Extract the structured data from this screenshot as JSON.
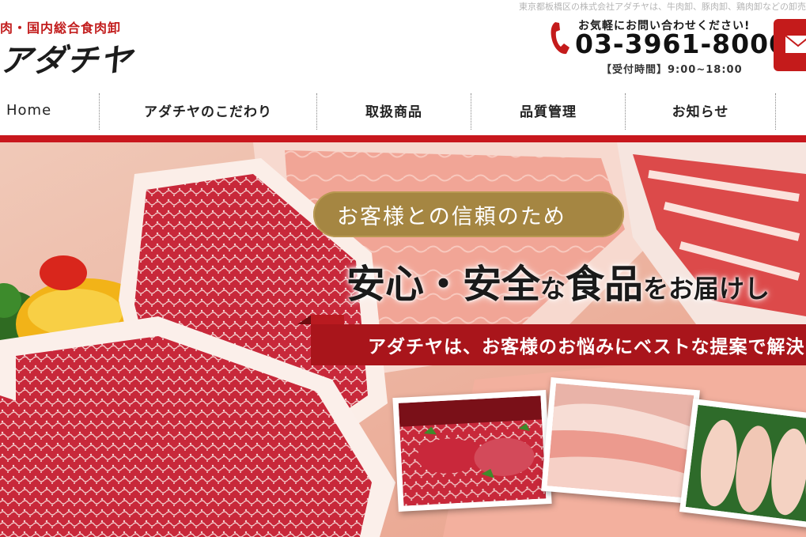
{
  "header": {
    "top_note": "東京都板橋区の株式会社アダチヤは、牛肉卸、豚肉卸、鶏肉卸などの卸売",
    "tagline": "肉・国内総合食肉卸",
    "logo_text": "アダチヤ",
    "contact": {
      "lead": "お気軽にお問い合わせください!",
      "phone": "03-3961-8000",
      "hours": "【受付時間】9:00~18:00"
    }
  },
  "nav": {
    "items": [
      {
        "label": "Home"
      },
      {
        "label": "アダチヤのこだわり"
      },
      {
        "label": "取扱商品"
      },
      {
        "label": "品質管理"
      },
      {
        "label": "お知らせ"
      }
    ]
  },
  "hero": {
    "pill_text": "お客様との信頼のため",
    "headline": {
      "part1": "安心・安全",
      "part2": "な",
      "part3": "食品",
      "part4": "をお届けし"
    },
    "ribbon_text": "アダチヤは、お客様のお悩みにベストな提案で解決し"
  },
  "colors": {
    "brand_red": "#c8171d",
    "gold": "#a58642",
    "ribbon_red": "#a9151b"
  },
  "icons": [
    "phone-icon",
    "mail-icon"
  ]
}
